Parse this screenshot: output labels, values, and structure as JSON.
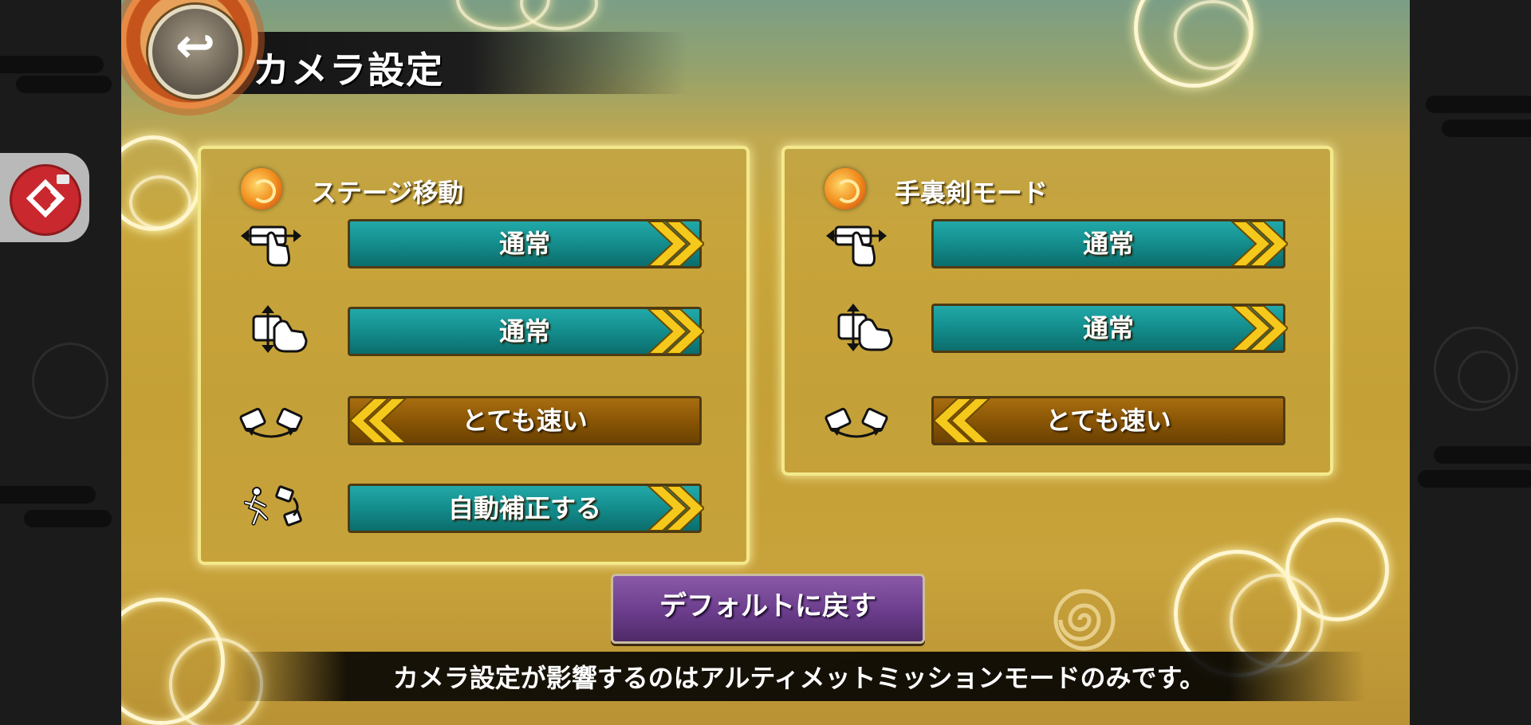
{
  "screen": {
    "title": "カメラ設定",
    "back_icon": "return-arrow-icon",
    "back_glyph": "↩"
  },
  "stage_panel": {
    "title": "ステージ移動",
    "rows": [
      {
        "icon": "swipe-horizontal-icon",
        "value": "通常",
        "arrow": "right"
      },
      {
        "icon": "swipe-vertical-icon",
        "value": "通常",
        "arrow": "right"
      },
      {
        "icon": "rotate-camera-icon",
        "value": "とても速い",
        "arrow": "left"
      },
      {
        "icon": "auto-correct-run-icon",
        "value": "自動補正する",
        "arrow": "right"
      }
    ]
  },
  "shuriken_panel": {
    "title": "手裏剣モード",
    "rows": [
      {
        "icon": "swipe-horizontal-icon",
        "value": "通常",
        "arrow": "right"
      },
      {
        "icon": "swipe-vertical-icon",
        "value": "通常",
        "arrow": "right"
      },
      {
        "icon": "rotate-camera-icon",
        "value": "とても速い",
        "arrow": "left"
      }
    ]
  },
  "reset_button": "デフォルトに戻す",
  "footer_note": "カメラ設定が影響するのはアルティメットミッションモードのみです。",
  "colors": {
    "teal_button": "#14908f",
    "brown_button": "#8a5605",
    "arrow_yellow": "#f5c81c",
    "panel_border": "#f3e98a",
    "reset_purple": "#6b3d8c"
  }
}
